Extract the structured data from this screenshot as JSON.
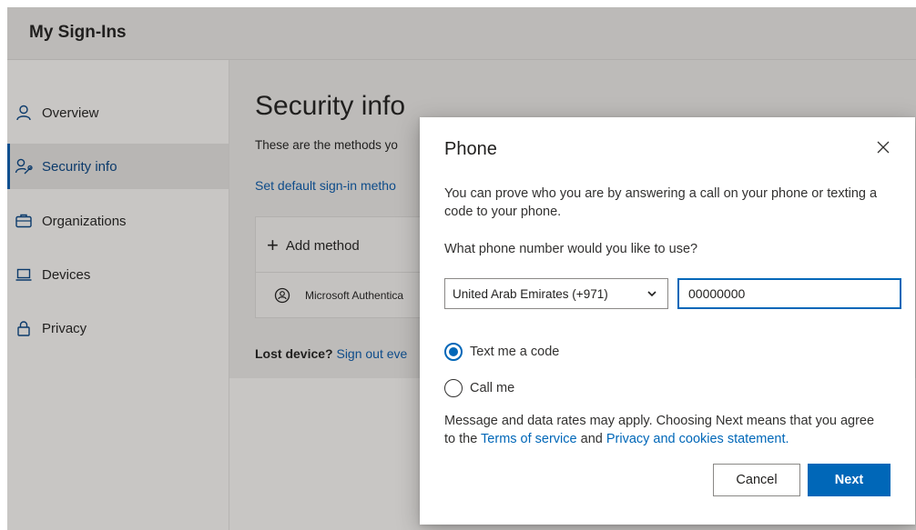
{
  "app": {
    "title": "My Sign-Ins"
  },
  "sidebar": {
    "items": [
      {
        "label": "Overview",
        "icon": "person-icon",
        "active": false
      },
      {
        "label": "Security info",
        "icon": "person-key-icon",
        "active": true
      },
      {
        "label": "Organizations",
        "icon": "briefcase-icon",
        "active": false
      },
      {
        "label": "Devices",
        "icon": "laptop-icon",
        "active": false
      },
      {
        "label": "Privacy",
        "icon": "lock-icon",
        "active": false
      }
    ]
  },
  "main": {
    "title": "Security info",
    "description": "These are the methods yo",
    "default_link": "Set default sign-in metho",
    "add_method": "Add method",
    "method_label": "Microsoft Authentica",
    "lost_device_prefix": "Lost device?",
    "lost_device_link": "Sign out eve"
  },
  "dialog": {
    "title": "Phone",
    "intro": "You can prove who you are by answering a call on your phone or texting a code to your phone.",
    "question": "What phone number would you like to use?",
    "country_selected": "United Arab Emirates (+971)",
    "phone_value": "00000000",
    "options": [
      {
        "label": "Text me a code",
        "checked": true
      },
      {
        "label": "Call me",
        "checked": false
      }
    ],
    "disclaimer_prefix": "Message and data rates may apply. Choosing Next means that you agree to the ",
    "terms_link": "Terms of service",
    "disclaimer_middle": " and ",
    "privacy_link": "Privacy and cookies statement.",
    "cancel_label": "Cancel",
    "next_label": "Next"
  },
  "colors": {
    "accent": "#0067b8",
    "overlay": "#c8c6c4",
    "active_indicator": "#0f4f8f"
  }
}
